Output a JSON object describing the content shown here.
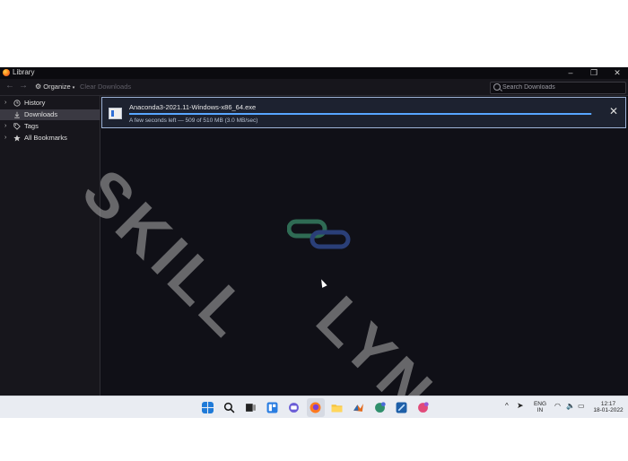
{
  "window": {
    "title": "Library"
  },
  "toolbar": {
    "organize_label": "Organize",
    "clear_label": "Clear Downloads",
    "search_placeholder": "Search Downloads"
  },
  "sidebar": {
    "items": [
      {
        "label": "History",
        "icon": "clock-icon"
      },
      {
        "label": "Downloads",
        "icon": "download-icon",
        "selected": true
      },
      {
        "label": "Tags",
        "icon": "tag-icon"
      },
      {
        "label": "All Bookmarks",
        "icon": "star-icon"
      }
    ]
  },
  "download": {
    "filename": "Anaconda3-2021.11-Windows-x86_64.exe",
    "status": "A few seconds left — 509 of 510 MB (3.0 MB/sec)",
    "progress_pct": 99.8
  },
  "watermark": {
    "line1": "SKILL",
    "line2": "LYNC"
  },
  "taskbar": {
    "icons": [
      "windows-start-icon",
      "search-icon",
      "task-view-icon",
      "widgets-icon",
      "chat-icon",
      "firefox-icon",
      "file-explorer-icon",
      "matlab-icon",
      "app-icon",
      "app-icon",
      "app-icon"
    ],
    "lang_top": "ENG",
    "lang_bottom": "IN",
    "time": "12:17",
    "date": "18-01-2022"
  }
}
